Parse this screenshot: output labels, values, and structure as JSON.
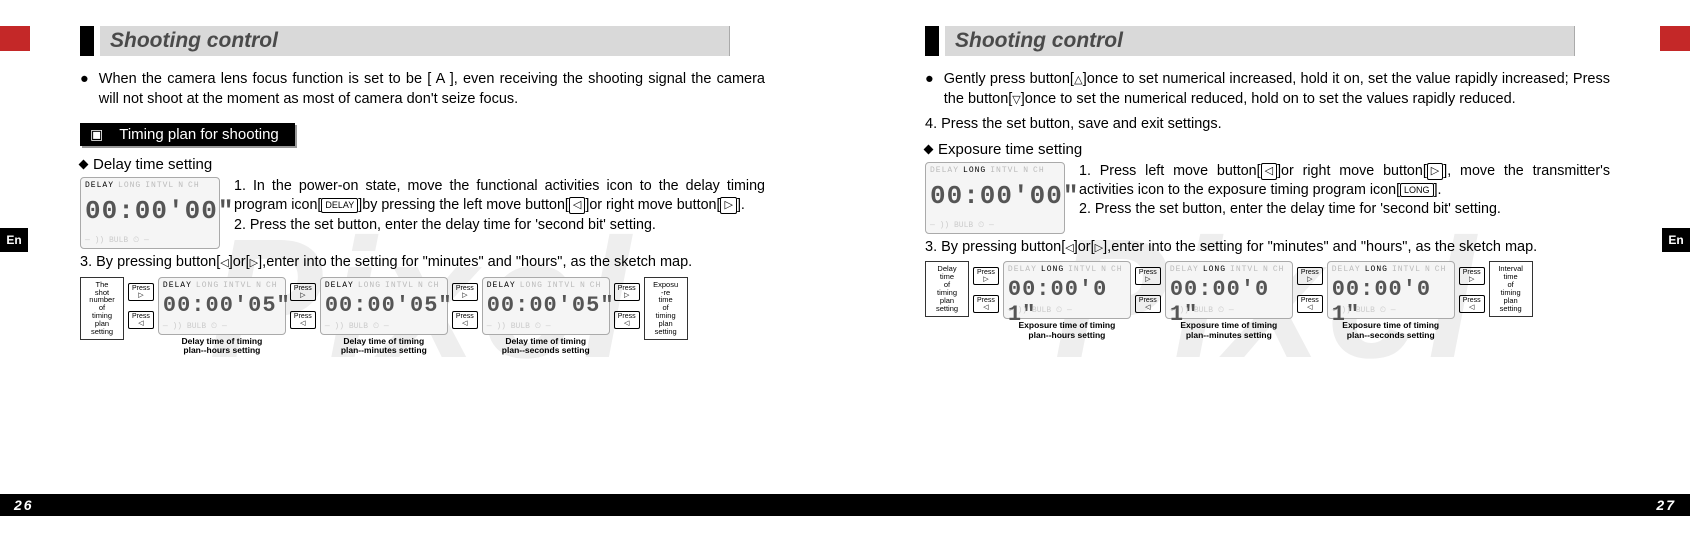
{
  "left": {
    "header": "Shooting control",
    "en": "En",
    "footer_page": "26",
    "watermark": "Pixel",
    "bullet": "When the camera lens focus function is set to be [ A ], even receiving the shooting signal the camera will not shoot at the moment as most of camera don't seize focus.",
    "timing_header": "Timing plan for  shooting",
    "sub": "Delay time setting",
    "lcd": {
      "labels": [
        "DELAY",
        "LONG",
        "INTVL",
        "N",
        "CH"
      ],
      "active": 0,
      "digits": "00:00'00\"",
      "bottom": "— )) BULB ⏲ —"
    },
    "p1": "1.   In  the  power-on  state,  move  the  functional  activities icon to the delay timing program icon[",
    "p1_icon": "DELAY",
    "p1b": "]by pressing the left move button[",
    "p1c": "]or right move button[",
    "p1d": "].",
    "p2": "2. Press the set button, enter the delay time for 'second bit' setting.",
    "p3a": "3.  By pressing button[",
    "p3b": "]or[",
    "p3c": "],enter into the setting for \"minutes\" and \"hours\", as the sketch map.",
    "seq": {
      "startBox": "The\nshot\nnumber\nof\ntiming\nplan\nsetting",
      "endBox": "Exposu\n-re\ntime\nof\ntiming\nplan\nsetting",
      "press": "Press",
      "steps": [
        {
          "digits": "00:00'05\"",
          "cap": "Delay time of timing\nplan--hours setting",
          "active": 0
        },
        {
          "digits": "00:00'05\"",
          "cap": "Delay time of timing\nplan--minutes setting",
          "active": 0
        },
        {
          "digits": "00:00'05\"",
          "cap": "Delay time of timing\nplan--seconds setting",
          "active": 0
        }
      ]
    }
  },
  "right": {
    "header": "Shooting control",
    "en": "En",
    "footer_page": "27",
    "watermark": "Pixel",
    "bullet_a": "Gently press button[",
    "bullet_b": "]once to set numerical increased, hold  it on, set the value rapidly increased; Press the button[",
    "bullet_c": "]once to set the  numerical  reduced, hold on to set  the values rapidly reduced.",
    "line4": "4.   Press the set button, save and exit settings.",
    "sub": "Exposure time setting",
    "lcd": {
      "labels": [
        "DELAY",
        "LONG",
        "INTVL",
        "N",
        "CH"
      ],
      "active": 1,
      "digits": "00:00'00\"",
      "bottom": "— )) BULB ⏲ —"
    },
    "p1": "1.   Press left move button[",
    "p1b": "]or right move button[",
    "p1c": "], move  the  transmitter's  activities  icon  to  the  exposure timing program icon[",
    "p1_icon": "LONG",
    "p1d": "].",
    "p2": "2. Press the set button, enter the delay time for 'second bit' setting.",
    "p3a": "3.  By pressing button[",
    "p3b": "]or[",
    "p3c": "],enter into the setting for \"minutes\" and \"hours\", as the sketch map.",
    "seq": {
      "startBox": "Delay\ntime\nof\ntiming\nplan\nsetting",
      "endBox": "Interval\ntime\nof\ntiming\nplan\nsetting",
      "press": "Press",
      "steps": [
        {
          "digits": "00:00'0 1\"",
          "cap": "Exposure time of timing\nplan--hours setting",
          "active": 1
        },
        {
          "digits": "00:00'0 1\"",
          "cap": "Exposure time of timing\nplan--minutes setting",
          "active": 1
        },
        {
          "digits": "00:00'0 1\"",
          "cap": "Exposure time of timing\nplan--seconds setting",
          "active": 1
        }
      ]
    }
  }
}
